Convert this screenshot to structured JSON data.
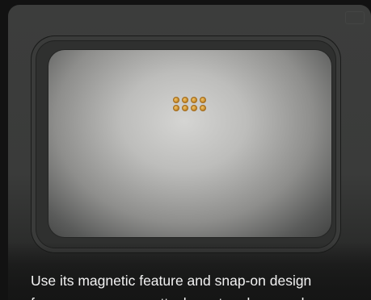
{
  "caption": {
    "line1": "Use its magnetic feature and snap-on design",
    "line2": "for easy accessory attachment and removal."
  },
  "colors": {
    "background": "#121212",
    "card": "#3a3b3a",
    "plate_center": "#d5d5d3",
    "pin_gold": "#c88d2f",
    "caption_text": "#f2f2f2"
  },
  "icons": {
    "connector": "pogo-pin-connector-icon"
  },
  "connector": {
    "rows": 2,
    "columns": 4
  }
}
